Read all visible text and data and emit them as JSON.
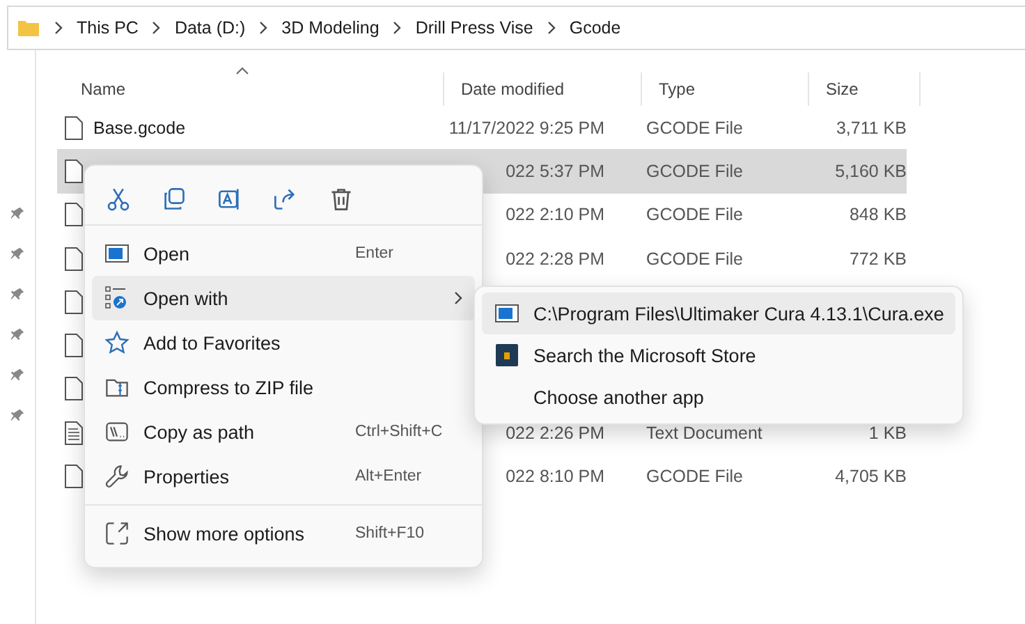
{
  "address_bar": {
    "crumbs": [
      "This PC",
      "Data (D:)",
      "3D Modeling",
      "Drill Press Vise",
      "Gcode"
    ]
  },
  "file_list": {
    "columns": [
      "Name",
      "Date modified",
      "Type",
      "Size"
    ],
    "rows": [
      {
        "kind": "file",
        "name": "Base.gcode",
        "date": "11/17/2022 9:25 PM",
        "type": "GCODE File",
        "size": "3,711 KB",
        "selected": false
      },
      {
        "kind": "file",
        "date": "022 5:37 PM",
        "type": "GCODE File",
        "size": "5,160 KB",
        "selected": true
      },
      {
        "kind": "file",
        "date": "022 2:10 PM",
        "type": "GCODE File",
        "size": "848 KB",
        "selected": false
      },
      {
        "kind": "file",
        "date": "022 2:28 PM",
        "type": "GCODE File",
        "size": "772 KB",
        "selected": false
      },
      {
        "kind": "file",
        "selected": false
      },
      {
        "kind": "file",
        "selected": false
      },
      {
        "kind": "file",
        "selected": false
      },
      {
        "kind": "text",
        "date": "022 2:26 PM",
        "type": "Text Document",
        "size": "1 KB",
        "selected": false
      },
      {
        "kind": "file",
        "date": "022 8:10 PM",
        "type": "GCODE File",
        "size": "4,705 KB",
        "selected": false
      }
    ]
  },
  "context_menu": {
    "quick_actions": [
      {
        "kind": "cut"
      },
      {
        "kind": "copy"
      },
      {
        "kind": "rename"
      },
      {
        "kind": "share"
      },
      {
        "kind": "delete"
      }
    ],
    "sections": [
      [
        {
          "kind": "open",
          "label": "Open",
          "shortcut": "Enter",
          "selected": false,
          "submenu": false
        },
        {
          "kind": "openwith",
          "label": "Open with",
          "selected": true,
          "submenu": true
        },
        {
          "kind": "star",
          "label": "Add to Favorites",
          "selected": false,
          "submenu": false
        },
        {
          "kind": "zip",
          "label": "Compress to ZIP file",
          "selected": false,
          "submenu": false
        },
        {
          "kind": "path",
          "label": "Copy as path",
          "shortcut": "Ctrl+Shift+C",
          "selected": false,
          "submenu": false
        },
        {
          "kind": "wrench",
          "label": "Properties",
          "shortcut": "Alt+Enter",
          "selected": false,
          "submenu": false
        }
      ],
      [
        {
          "kind": "more",
          "label": "Show more options",
          "shortcut": "Shift+F10",
          "selected": false,
          "submenu": false
        }
      ]
    ]
  },
  "submenu": {
    "items": [
      {
        "kind": "app",
        "label": "C:\\Program Files\\Ultimaker Cura 4.13.1\\Cura.exe",
        "selected": true
      },
      {
        "kind": "store",
        "label": "Search the Microsoft Store",
        "selected": false
      },
      {
        "kind": "none",
        "label": "Choose another app",
        "selected": false
      }
    ]
  }
}
